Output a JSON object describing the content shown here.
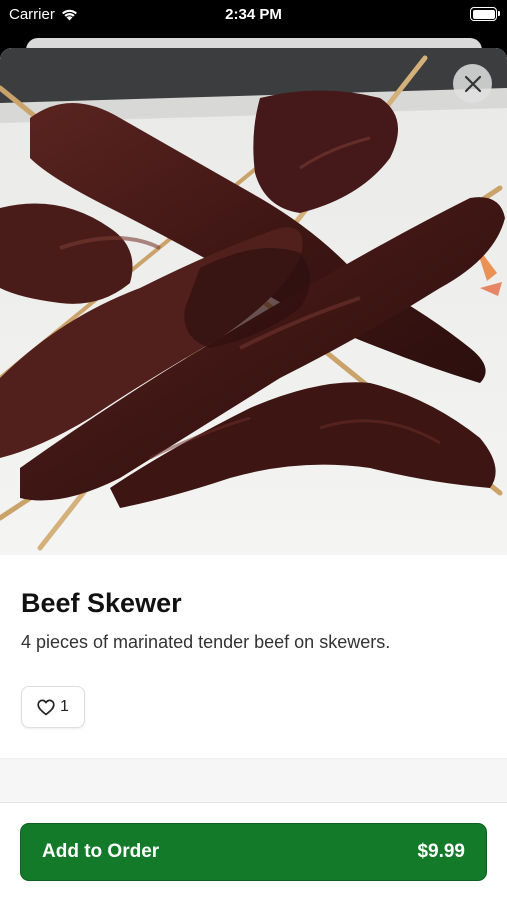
{
  "status_bar": {
    "carrier": "Carrier",
    "time": "2:34 PM"
  },
  "item": {
    "image_alt": "Beef Skewer photo",
    "title": "Beef Skewer",
    "description": "4 pieces of marinated tender beef on skewers.",
    "likes": "1"
  },
  "order": {
    "button_label": "Add to Order",
    "price": "$9.99"
  },
  "colors": {
    "primary": "#137a2a"
  }
}
